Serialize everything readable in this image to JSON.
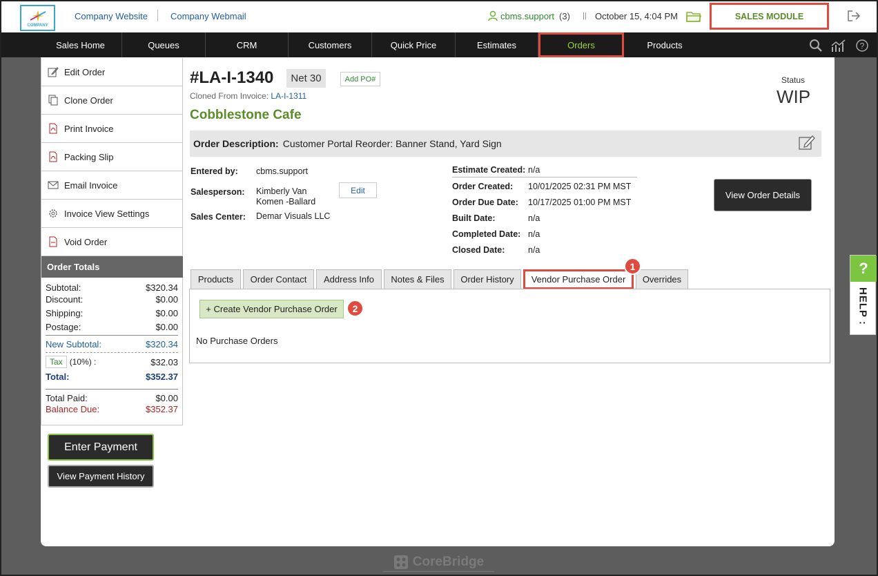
{
  "header": {
    "logo_text": "COMPANY",
    "links": [
      "Company Website",
      "Company Webmail"
    ],
    "user_name": "cbms.support",
    "user_count": "(3)",
    "datetime": "October 15, 4:04 PM",
    "module_label": "SALES MODULE"
  },
  "nav": {
    "items": [
      "Sales Home",
      "Queues",
      "CRM",
      "Customers",
      "Quick Price",
      "Estimates",
      "Orders",
      "Products"
    ],
    "active": "Orders"
  },
  "sidebar": {
    "items": [
      "Edit Order",
      "Clone Order",
      "Print Invoice",
      "Packing Slip",
      "Email Invoice",
      "Invoice View Settings",
      "Void Order"
    ],
    "icons": [
      "edit-icon",
      "clone-icon",
      "pdf-icon",
      "pdf-icon",
      "mail-icon",
      "gear-icon",
      "void-icon"
    ]
  },
  "totals": {
    "heading": "Order Totals",
    "subtotal_label": "Subtotal:",
    "subtotal": "$320.34",
    "discount_label": "Discount:",
    "discount": "$0.00",
    "shipping_label": "Shipping:",
    "shipping": "$0.00",
    "postage_label": "Postage:",
    "postage": "$0.00",
    "new_subtotal_label": "New Subtotal:",
    "new_subtotal": "$320.34",
    "tax_label": "Tax",
    "tax_rate": "(10%) :",
    "tax": "$32.03",
    "total_label": "Total:",
    "total": "$352.37",
    "paid_label": "Total Paid:",
    "paid": "$0.00",
    "balance_label": "Balance Due:",
    "balance": "$352.37"
  },
  "buttons": {
    "enter_payment": "Enter Payment",
    "payment_history": "View Payment History",
    "view_order_details": "View Order Details",
    "edit": "Edit",
    "add_po": "Add PO#",
    "create_vpo": "+ Create Vendor Purchase Order"
  },
  "order": {
    "number": "#LA-I-1340",
    "terms": "Net 30",
    "cloned_from_label": "Cloned From Invoice:",
    "cloned_from": "LA-I-1311",
    "customer": "Cobblestone Cafe",
    "status_label": "Status",
    "status": "WIP",
    "description_label": "Order Description:",
    "description": "Customer Portal Reorder: Banner Stand, Yard Sign",
    "entered_by_label": "Entered by:",
    "entered_by": "cbms.support",
    "salesperson_label": "Salesperson:",
    "salesperson_line1": "Kimberly Van",
    "salesperson_line2": "Komen -Ballard",
    "sales_center_label": "Sales Center:",
    "sales_center": "Demar Visuals LLC",
    "estimate_created_label": "Estimate Created:",
    "estimate_created": "n/a",
    "order_created_label": "Order Created:",
    "order_created": "10/01/2025 02:31 PM MST",
    "order_due_label": "Order Due Date:",
    "order_due": "10/17/2025 01:00 PM MST",
    "built_label": "Built Date:",
    "built": "n/a",
    "completed_label": "Completed Date:",
    "completed": "n/a",
    "closed_label": "Closed Date:",
    "closed": "n/a"
  },
  "tabs": {
    "items": [
      "Products",
      "Order Contact",
      "Address Info",
      "Notes & Files",
      "Order History",
      "Vendor Purchase Order",
      "Overrides"
    ],
    "active": "Vendor Purchase Order"
  },
  "panel": {
    "empty_text": "No Purchase Orders"
  },
  "annotations": {
    "badge1": "1",
    "badge2": "2"
  },
  "help": {
    "q": "?",
    "label": "HELP :"
  },
  "footer": {
    "brand": "CoreBridge"
  },
  "colors": {
    "accent_green": "#5a8c2a",
    "highlight_red": "#e04b3f",
    "link_blue": "#1f5fa3",
    "nav_bg": "#1b1b1b"
  }
}
